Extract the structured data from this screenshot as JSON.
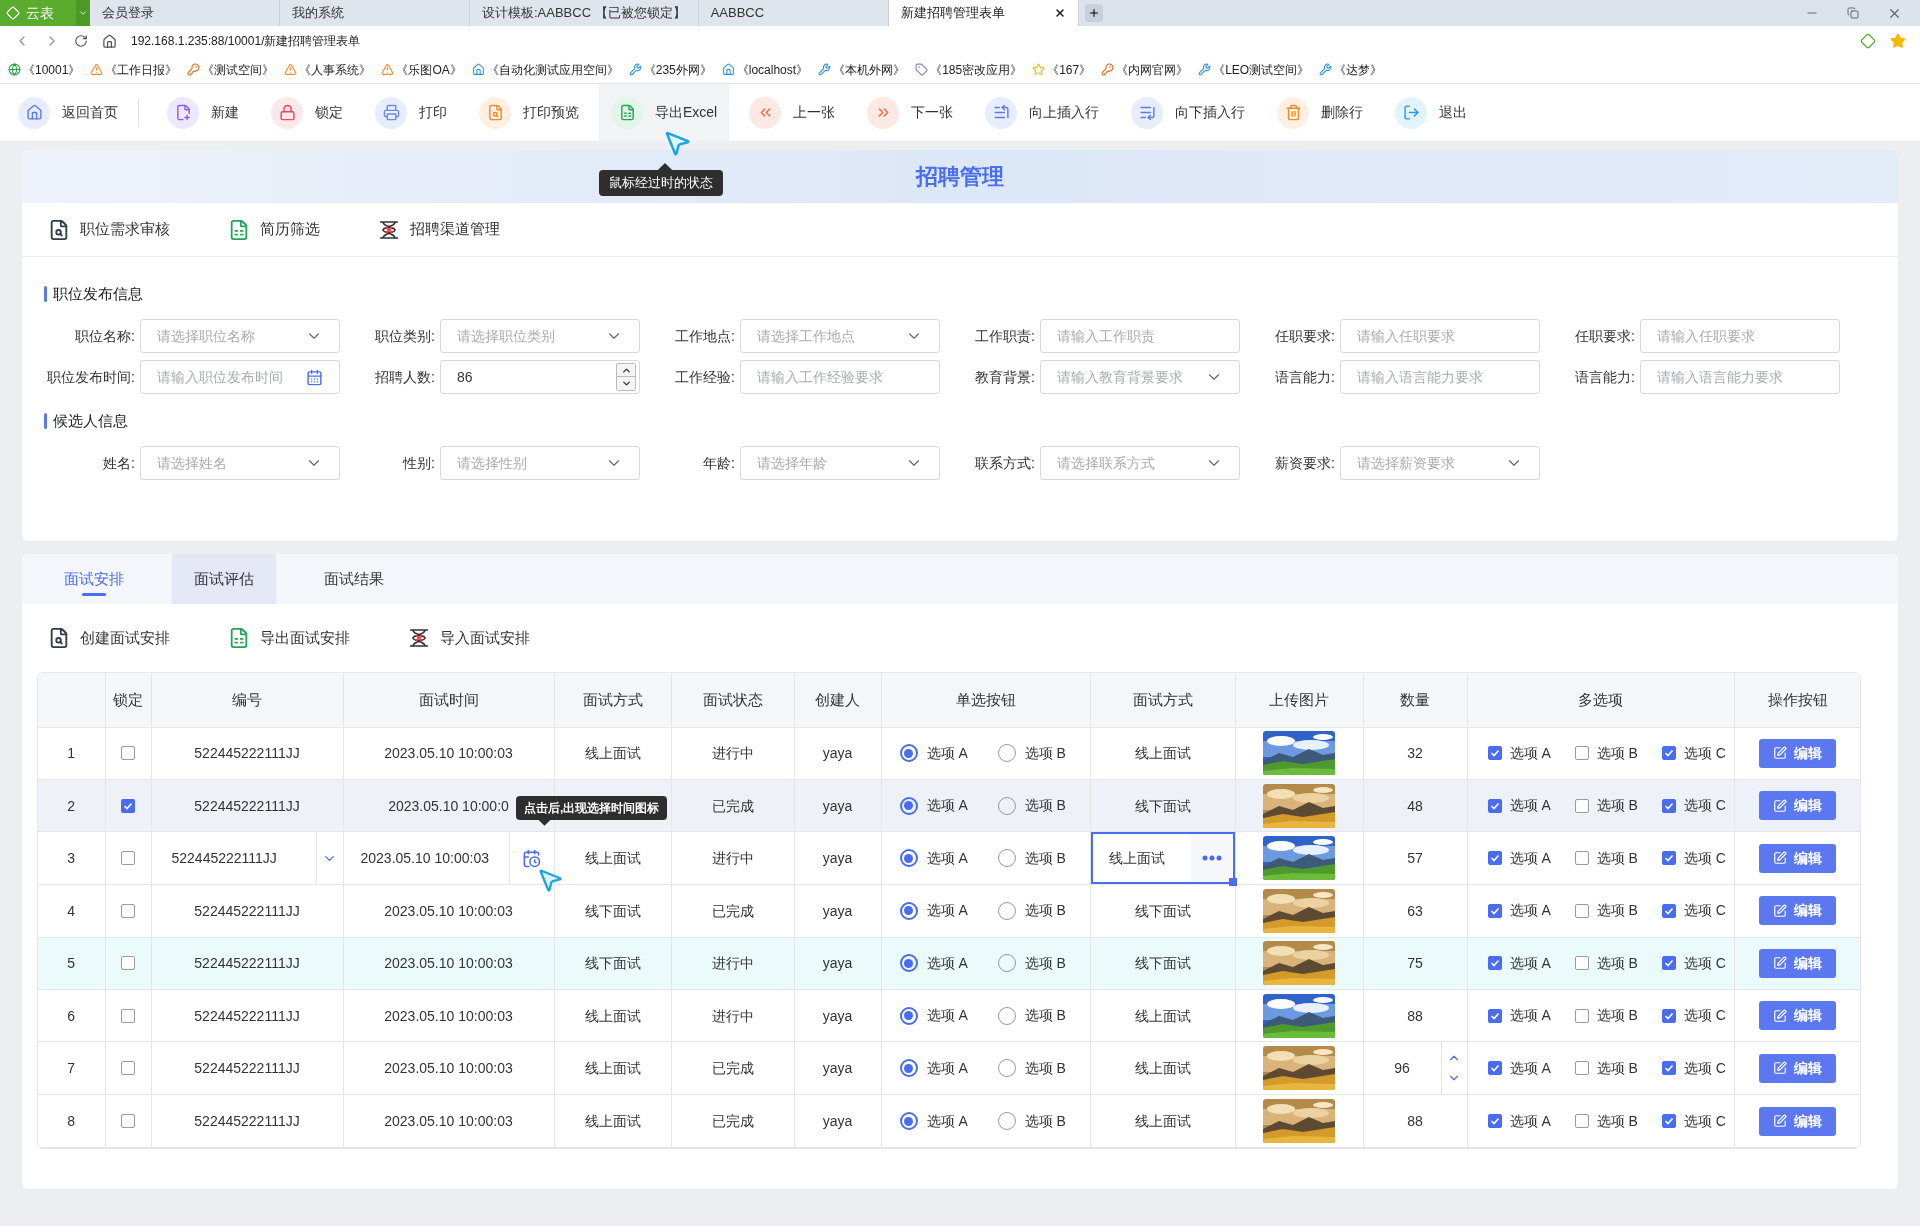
{
  "browser": {
    "brand": "云表",
    "tabs": [
      {
        "label": "会员登录",
        "selected": false
      },
      {
        "label": "我的系统",
        "selected": false
      },
      {
        "label": "设计模板:AABBCC 【已被您锁定】",
        "selected": false
      },
      {
        "label": "AABBCC",
        "selected": false
      },
      {
        "label": "新建招聘管理表单",
        "selected": true
      }
    ],
    "address": "192.168.1.235:88/10001/新建招聘管理表单",
    "bookmarks": [
      "《10001》",
      "《工作日报》",
      "《测试空间》",
      "《人事系统》",
      "《乐图OA》",
      "《自动化测试应用空间》",
      "《235外网》",
      "《localhost》",
      "《本机外网》",
      "《185密改应用》",
      "《167》",
      "《内网官网》",
      "《LEO测试空间》",
      "《达梦》"
    ]
  },
  "toolbar": [
    {
      "label": "返回首页",
      "hovered": false
    },
    {
      "label": "新建",
      "hovered": false
    },
    {
      "label": "锁定",
      "hovered": false
    },
    {
      "label": "打印",
      "hovered": false
    },
    {
      "label": "打印预览",
      "hovered": false
    },
    {
      "label": "导出Excel",
      "hovered": true
    },
    {
      "label": "上一张",
      "hovered": false
    },
    {
      "label": "下一张",
      "hovered": false
    },
    {
      "label": "向上插入行",
      "hovered": false
    },
    {
      "label": "向下插入行",
      "hovered": false
    },
    {
      "label": "删除行",
      "hovered": false
    },
    {
      "label": "退出",
      "hovered": false
    }
  ],
  "toolbar_tooltip": "鼠标经过时的状态",
  "form": {
    "title": "招聘管理",
    "actions": [
      "职位需求审核",
      "简历筛选",
      "招聘渠道管理"
    ],
    "sections": [
      {
        "title": "职位发布信息",
        "fields": [
          {
            "label": "职位名称:",
            "kind": "select",
            "placeholder": "请选择职位名称"
          },
          {
            "label": "职位类别:",
            "kind": "select",
            "placeholder": "请选择职位类别"
          },
          {
            "label": "工作地点:",
            "kind": "select",
            "placeholder": "请选择工作地点"
          },
          {
            "label": "工作职责:",
            "kind": "input",
            "placeholder": "请输入工作职责"
          },
          {
            "label": "任职要求:",
            "kind": "input",
            "placeholder": "请输入任职要求"
          },
          {
            "label": "任职要求:",
            "kind": "input",
            "placeholder": "请输入任职要求"
          },
          {
            "label": "职位发布时间:",
            "kind": "date",
            "placeholder": "请输入职位发布时间"
          },
          {
            "label": "招聘人数:",
            "kind": "number",
            "value": "86"
          },
          {
            "label": "工作经验:",
            "kind": "input",
            "placeholder": "请输入工作经验要求"
          },
          {
            "label": "教育背景:",
            "kind": "select",
            "placeholder": "请输入教育背景要求"
          },
          {
            "label": "语言能力:",
            "kind": "input",
            "placeholder": "请输入语言能力要求"
          },
          {
            "label": "语言能力:",
            "kind": "input",
            "placeholder": "请输入语言能力要求"
          }
        ]
      },
      {
        "title": "候选人信息",
        "fields": [
          {
            "label": "姓名:",
            "kind": "select",
            "placeholder": "请选择姓名"
          },
          {
            "label": "性别:",
            "kind": "select",
            "placeholder": "请选择性别"
          },
          {
            "label": "年龄:",
            "kind": "select",
            "placeholder": "请选择年龄"
          },
          {
            "label": "联系方式:",
            "kind": "select",
            "placeholder": "请选择联系方式"
          },
          {
            "label": "薪资要求:",
            "kind": "select",
            "placeholder": "请选择薪资要求"
          }
        ]
      }
    ]
  },
  "interview": {
    "tabs": [
      {
        "label": "面试安排",
        "selected": true,
        "hovered": false
      },
      {
        "label": "面试评估",
        "selected": false,
        "hovered": true
      },
      {
        "label": "面试结果",
        "selected": false,
        "hovered": false
      }
    ],
    "actions": [
      "创建面试安排",
      "导出面试安排",
      "导入面试安排"
    ],
    "table": {
      "columns": [
        "锁定",
        "编号",
        "面试时间",
        "面试方式",
        "面试状态",
        "创建人",
        "单选按钮",
        "面试方式",
        "上传图片",
        "数量",
        "多选项",
        "操作按钮"
      ],
      "rows": [
        {
          "index": "1",
          "locked": false,
          "selected": false,
          "hovered": false,
          "editing": false,
          "code": "522445222111JJ",
          "time": "2023.05.10 10:00:03",
          "mode": "线上面试",
          "status": "进行中",
          "creator": "yaya",
          "radios": [
            {
              "label": "选项 A",
              "selected": true
            },
            {
              "label": "选项 B",
              "selected": false
            }
          ],
          "mode2": "线上面试",
          "quantity": "32",
          "spinner": false,
          "options": [
            {
              "label": "选项 A",
              "checked": true
            },
            {
              "label": "选项 B",
              "checked": false
            },
            {
              "label": "选项 C",
              "checked": true
            }
          ],
          "action": "编辑"
        },
        {
          "index": "2",
          "locked": true,
          "selected": true,
          "hovered": false,
          "editing": false,
          "code": "522445222111JJ",
          "time": "2023.05.10 10:00:0",
          "status": "已完成",
          "creator": "yaya",
          "radios": [
            {
              "label": "选项 A",
              "selected": true
            },
            {
              "label": "选项 B",
              "selected": false
            }
          ],
          "mode2": "线下面试",
          "quantity": "48",
          "spinner": false,
          "options": [
            {
              "label": "选项 A",
              "checked": true
            },
            {
              "label": "选项 B",
              "checked": false
            },
            {
              "label": "选项 C",
              "checked": true
            }
          ],
          "action": "编辑"
        },
        {
          "index": "3",
          "locked": false,
          "selected": false,
          "hovered": false,
          "editing": true,
          "code": "522445222111JJ",
          "time": "2023.05.10 10:00:03",
          "mode": "线上面试",
          "status": "进行中",
          "creator": "yaya",
          "radios": [
            {
              "label": "选项 A",
              "selected": true
            },
            {
              "label": "选项 B",
              "selected": false
            }
          ],
          "mode2": "线上面试",
          "quantity": "57",
          "spinner": false,
          "options": [
            {
              "label": "选项 A",
              "checked": true
            },
            {
              "label": "选项 B",
              "checked": false
            },
            {
              "label": "选项 C",
              "checked": true
            }
          ],
          "action": "编辑"
        },
        {
          "index": "4",
          "locked": false,
          "selected": false,
          "hovered": false,
          "editing": false,
          "code": "522445222111JJ",
          "time": "2023.05.10 10:00:03",
          "mode": "线下面试",
          "status": "已完成",
          "creator": "yaya",
          "radios": [
            {
              "label": "选项 A",
              "selected": true
            },
            {
              "label": "选项 B",
              "selected": false
            }
          ],
          "mode2": "线下面试",
          "quantity": "63",
          "spinner": false,
          "options": [
            {
              "label": "选项 A",
              "checked": true
            },
            {
              "label": "选项 B",
              "checked": false
            },
            {
              "label": "选项 C",
              "checked": true
            }
          ],
          "action": "编辑"
        },
        {
          "index": "5",
          "locked": false,
          "selected": false,
          "hovered": true,
          "editing": false,
          "code": "522445222111JJ",
          "time": "2023.05.10 10:00:03",
          "mode": "线下面试",
          "status": "进行中",
          "creator": "yaya",
          "radios": [
            {
              "label": "选项 A",
              "selected": true
            },
            {
              "label": "选项 B",
              "selected": false
            }
          ],
          "mode2": "线下面试",
          "quantity": "75",
          "spinner": false,
          "options": [
            {
              "label": "选项 A",
              "checked": true
            },
            {
              "label": "选项 B",
              "checked": false
            },
            {
              "label": "选项 C",
              "checked": true
            }
          ],
          "action": "编辑"
        },
        {
          "index": "6",
          "locked": false,
          "selected": false,
          "hovered": false,
          "editing": false,
          "code": "522445222111JJ",
          "time": "2023.05.10 10:00:03",
          "mode": "线上面试",
          "status": "进行中",
          "creator": "yaya",
          "radios": [
            {
              "label": "选项 A",
              "selected": true
            },
            {
              "label": "选项 B",
              "selected": false
            }
          ],
          "mode2": "线上面试",
          "quantity": "88",
          "spinner": false,
          "options": [
            {
              "label": "选项 A",
              "checked": true
            },
            {
              "label": "选项 B",
              "checked": false
            },
            {
              "label": "选项 C",
              "checked": true
            }
          ],
          "action": "编辑"
        },
        {
          "index": "7",
          "locked": false,
          "selected": false,
          "hovered": false,
          "editing": false,
          "code": "522445222111JJ",
          "time": "2023.05.10 10:00:03",
          "mode": "线上面试",
          "status": "已完成",
          "creator": "yaya",
          "radios": [
            {
              "label": "选项 A",
              "selected": true
            },
            {
              "label": "选项 B",
              "selected": false
            }
          ],
          "mode2": "线上面试",
          "quantity": "96",
          "spinner": true,
          "options": [
            {
              "label": "选项 A",
              "checked": true
            },
            {
              "label": "选项 B",
              "checked": false
            },
            {
              "label": "选项 C",
              "checked": true
            }
          ],
          "action": "编辑"
        },
        {
          "index": "8",
          "locked": false,
          "selected": false,
          "hovered": false,
          "editing": false,
          "code": "522445222111JJ",
          "time": "2023.05.10 10:00:03",
          "mode": "线上面试",
          "status": "已完成",
          "creator": "yaya",
          "radios": [
            {
              "label": "选项 A",
              "selected": true
            },
            {
              "label": "选项 B",
              "selected": false
            }
          ],
          "mode2": "线上面试",
          "quantity": "88",
          "spinner": false,
          "options": [
            {
              "label": "选项 A",
              "checked": true
            },
            {
              "label": "选项 B",
              "checked": false
            },
            {
              "label": "选项 C",
              "checked": true
            }
          ],
          "action": "编辑"
        }
      ]
    },
    "tooltip": "点击后,出现选择时间图标"
  }
}
